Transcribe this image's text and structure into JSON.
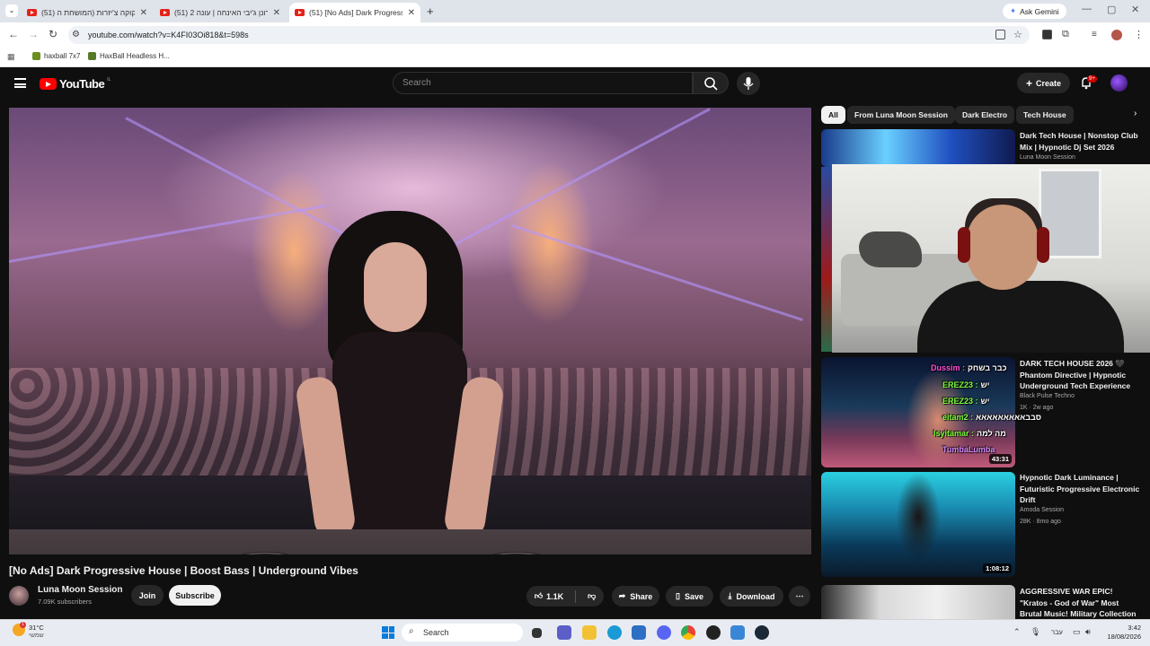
{
  "browser": {
    "tabs": [
      {
        "label": "(51) הקוקה צ'יזרות (המושחת ה"
      },
      {
        "label": "(51) רונן ג'יבי האינחה | עונה 2"
      },
      {
        "label": "(51) [No Ads] Dark Progressi"
      }
    ],
    "new_tab": "+",
    "ask_gemini": "Ask Gemini",
    "url": "youtube.com/watch?v=K4FI03Oi818&t=598s",
    "bookmarks": [
      {
        "label": "haxball 7x7"
      },
      {
        "label": "HaxBall Headless H..."
      }
    ]
  },
  "youtube": {
    "logo": "YouTube",
    "logo_country": "IL",
    "search_placeholder": "Search",
    "create_label": "Create",
    "notifications_badge": "9+",
    "chips": [
      "All",
      "From Luna Moon Session",
      "Dark Electro",
      "Tech House"
    ],
    "video": {
      "title": "[No Ads] Dark Progressive House | Boost Bass | Underground Vibes",
      "channel": "Luna Moon Session",
      "subscribers": "7.09K subscribers",
      "join_label": "Join",
      "subscribe_label": "Subscribe",
      "likes": "1.1K",
      "share_label": "Share",
      "save_label": "Save",
      "download_label": "Download"
    },
    "recommendations": [
      {
        "title": "Dark Tech House | Nonstop Club Mix | Hypnotic Dj Set 2026",
        "channel": "Luna Moon Session"
      },
      {
        "title": "DARK TECH HOUSE 2026 🖤 Phantom Directive | Hypnotic Underground Tech Experience",
        "channel": "Black Pulse Techno",
        "meta": "1K · 2w ago",
        "duration": "43:31"
      },
      {
        "title": "Hypnotic Dark Luminance | Futuristic Progressive Electronic Drift",
        "channel": "Amoda Session",
        "meta": "28K · 8mo ago",
        "duration": "1:08:12"
      },
      {
        "title": "AGGRESSIVE WAR EPIC! \"Kratos - God of War\" Most Brutal Music! Military Collection"
      }
    ]
  },
  "chat": [
    {
      "user": "Dussim",
      "msg": "כבר בשחק",
      "color": "#ff4fd8"
    },
    {
      "user": "EREZ23",
      "msg": "יש",
      "color": "#7dff3a"
    },
    {
      "user": "EREZ23",
      "msg": "יש",
      "color": "#7dff3a"
    },
    {
      "user": "eitam2",
      "msg": "סבבאאאאאאאאא",
      "color": "#7dff3a"
    },
    {
      "user": "Isyitamar",
      "msg": "מה למה",
      "color": "#7dff3a"
    },
    {
      "user": "TumbaLumba",
      "msg": "",
      "color": "#d98cff"
    }
  ],
  "taskbar": {
    "temperature": "31°C",
    "weather_sub": "שמשי",
    "weather_badge": "1",
    "search_label": "Search",
    "time": "3:42",
    "date": "18/08/2026",
    "lang": "עבר"
  },
  "colors": {
    "yt_red": "#ff0000",
    "bg": "#0f0f0f",
    "chip": "#272727"
  }
}
